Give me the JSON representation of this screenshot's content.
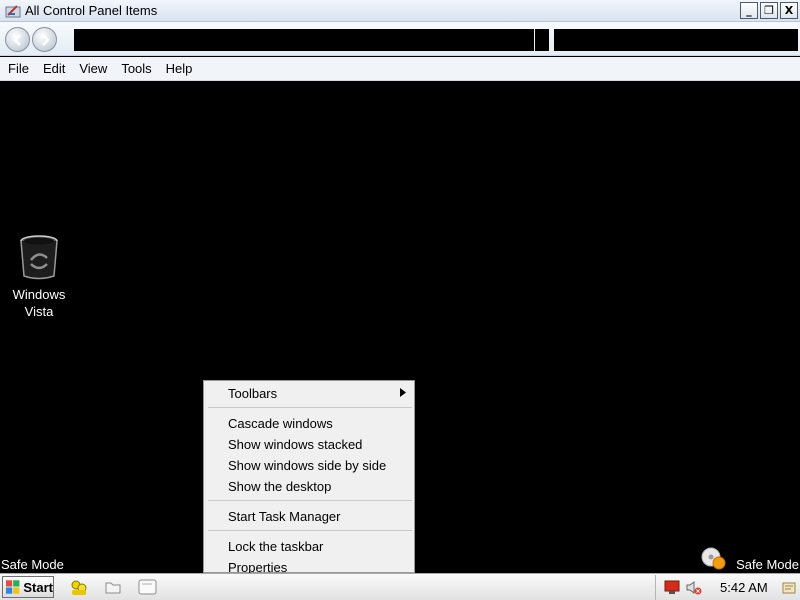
{
  "window": {
    "title": "All Control Panel Items",
    "controls": {
      "minimize": "_",
      "restore": "❐",
      "close": "X"
    }
  },
  "navigation": {
    "back_icon": "back-arrow-icon",
    "forward_icon": "forward-arrow-icon"
  },
  "menubar": [
    "File",
    "Edit",
    "View",
    "Tools",
    "Help"
  ],
  "desktop": {
    "icon_label_line1": "Windows",
    "icon_label_line2": "Vista",
    "safe_mode_left": "Safe Mode",
    "safe_mode_right": "Safe Mode"
  },
  "context_menu": {
    "toolbars": "Toolbars",
    "cascade": "Cascade windows",
    "stacked": "Show windows stacked",
    "side_by_side": "Show windows side by side",
    "show_desktop": "Show the desktop",
    "task_manager": "Start Task Manager",
    "lock_taskbar": "Lock the taskbar",
    "properties": "Properties"
  },
  "taskbar": {
    "start_label": "Start",
    "clock": "5:42 AM"
  },
  "colors": {
    "desktop": "#000000",
    "menu_bg": "#f0f0f0",
    "taskbar": "#e8e8e8"
  }
}
